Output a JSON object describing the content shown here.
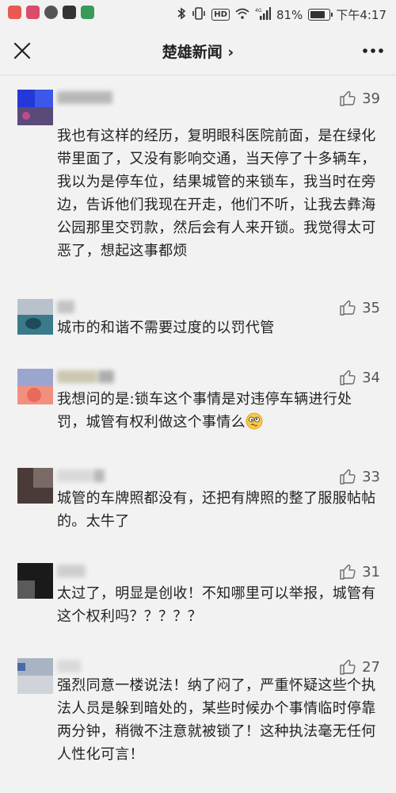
{
  "status_bar": {
    "battery": "81%",
    "time": "下午4:17",
    "network": "4G"
  },
  "header": {
    "title": "楚雄新闻 ›"
  },
  "comments": [
    {
      "likes": "39",
      "text": "我也有这样的经历，复明眼科医院前面，是在绿化带里面了，又没有影响交通，当天停了十多辆车，我以为是停车位，结果城管的来锁车，我当时在旁边，告诉他们我现在开走，他们不听，让我去彝海公园那里交罚款，然后会有人来开锁。我觉得太可恶了，想起这事都烦"
    },
    {
      "likes": "35",
      "text": "城市的和谐不需要过度的以罚代管"
    },
    {
      "likes": "34",
      "text": "我想问的是:锁车这个事情是对违停车辆进行处罚，城管有权利做这个事情么"
    },
    {
      "likes": "33",
      "text": "城管的车牌照都没有，还把有牌照的整了服服帖帖的。太牛了"
    },
    {
      "likes": "31",
      "text": "太过了，明显是创收！不知哪里可以举报，城管有这个权利吗？？？？？"
    },
    {
      "likes": "27",
      "text": "强烈同意一楼说法！纳了闷了，严重怀疑这些个执法人员是躲到暗处的，某些时候办个事情临时停靠两分钟，稍微不注意就被锁了！这种执法毫无任何人性化可言！"
    }
  ]
}
